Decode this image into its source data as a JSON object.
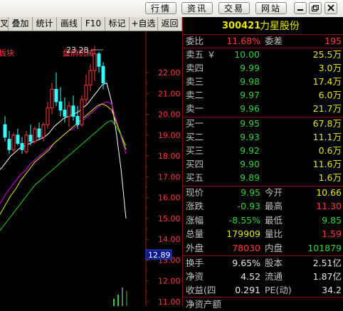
{
  "topbar": {
    "buttons": [
      "行情",
      "资讯",
      "交易",
      "网站"
    ],
    "window_controls": [
      "minimize-icon",
      "restore-icon",
      "close-icon"
    ]
  },
  "toolbar": {
    "items": [
      "叉",
      "叠加",
      "统计",
      "画线",
      "F10",
      "标记",
      "+自选",
      "返回"
    ]
  },
  "chart": {
    "annotations": [
      "板块",
      "盘前机械",
      "23.28"
    ],
    "y_ticks": [
      "22.00",
      "21.00",
      "20.00",
      "19.00",
      "18.00",
      "17.00",
      "16.00",
      "15.00",
      "14.00",
      "13.00",
      "12.00",
      "11.00"
    ],
    "current_price_tag": "12.89",
    "colors": {
      "up": "#ff3a3a",
      "down": "#33ffff",
      "ma_white": "#ffffff",
      "ma_yellow": "#e8e800",
      "ma_magenta": "#e000e0",
      "ma_green": "#20d020",
      "volume": "#31d13a"
    }
  },
  "chart_data": {
    "type": "candlestick",
    "y_range": [
      10.8,
      23.5
    ],
    "candles": [
      {
        "o": 19.5,
        "h": 19.9,
        "l": 18.7,
        "c": 18.9
      },
      {
        "o": 18.8,
        "h": 19.2,
        "l": 18.1,
        "c": 18.3
      },
      {
        "o": 18.3,
        "h": 19.1,
        "l": 18.2,
        "c": 19.0
      },
      {
        "o": 19.0,
        "h": 19.3,
        "l": 18.5,
        "c": 18.6
      },
      {
        "o": 18.6,
        "h": 18.9,
        "l": 18.1,
        "c": 18.3
      },
      {
        "o": 18.2,
        "h": 19.2,
        "l": 18.1,
        "c": 19.0
      },
      {
        "o": 19.0,
        "h": 19.5,
        "l": 18.5,
        "c": 18.7
      },
      {
        "o": 18.7,
        "h": 19.4,
        "l": 18.6,
        "c": 19.3
      },
      {
        "o": 19.3,
        "h": 19.6,
        "l": 18.8,
        "c": 18.9
      },
      {
        "o": 18.9,
        "h": 19.6,
        "l": 18.7,
        "c": 19.5
      },
      {
        "o": 19.5,
        "h": 20.6,
        "l": 19.3,
        "c": 20.3
      },
      {
        "o": 20.3,
        "h": 21.5,
        "l": 20.0,
        "c": 21.2
      },
      {
        "o": 21.2,
        "h": 22.0,
        "l": 20.4,
        "c": 20.6
      },
      {
        "o": 20.6,
        "h": 21.3,
        "l": 19.9,
        "c": 20.2
      },
      {
        "o": 20.2,
        "h": 20.8,
        "l": 19.6,
        "c": 19.9
      },
      {
        "o": 19.9,
        "h": 20.6,
        "l": 19.4,
        "c": 20.4
      },
      {
        "o": 20.4,
        "h": 20.9,
        "l": 19.7,
        "c": 19.9
      },
      {
        "o": 19.9,
        "h": 20.4,
        "l": 19.3,
        "c": 19.5
      },
      {
        "o": 19.5,
        "h": 20.9,
        "l": 19.4,
        "c": 20.7
      },
      {
        "o": 20.7,
        "h": 21.9,
        "l": 20.5,
        "c": 21.4
      },
      {
        "o": 21.4,
        "h": 22.4,
        "l": 21.1,
        "c": 22.1
      },
      {
        "o": 22.1,
        "h": 23.28,
        "l": 21.6,
        "c": 22.9
      },
      {
        "o": 22.9,
        "h": 23.0,
        "l": 22.0,
        "c": 22.3
      },
      {
        "o": 22.3,
        "h": 22.5,
        "l": 21.2,
        "c": 21.5
      }
    ],
    "ma": [
      {
        "name": "MA-white",
        "color": "#ffffff",
        "values": [
          17.2,
          17.4,
          17.7,
          18.0,
          18.2,
          18.4,
          18.5,
          18.6,
          18.7,
          18.8,
          18.9,
          19.1,
          19.4,
          19.6,
          19.8,
          19.9,
          20.0,
          20.1,
          20.3,
          20.5,
          20.8,
          21.1,
          21.4,
          21.5,
          20.6,
          19.1,
          17.3,
          15.0
        ]
      },
      {
        "name": "MA-magenta",
        "color": "#e000e0",
        "values": [
          15.5,
          15.8,
          16.2,
          16.5,
          16.8,
          17.1,
          17.3,
          17.6,
          17.8,
          18.0,
          18.2,
          18.4,
          18.6,
          18.8,
          19.0,
          19.2,
          19.3,
          19.5,
          19.7,
          19.9,
          20.1,
          20.3,
          20.5,
          20.6,
          20.5,
          19.7,
          18.9,
          18.1
        ]
      },
      {
        "name": "MA-yellow",
        "color": "#e8e800",
        "values": [
          14.9,
          15.3,
          15.7,
          16.1,
          16.4,
          16.8,
          17.1,
          17.4,
          17.7,
          17.9,
          18.1,
          18.3,
          18.6,
          18.8,
          19.0,
          19.2,
          19.4,
          19.6,
          19.8,
          20.0,
          20.2,
          20.4,
          20.5,
          20.4,
          20.2,
          19.6,
          19.0,
          18.3
        ]
      },
      {
        "name": "MA-green",
        "color": "#20d020",
        "values": [
          14.2,
          14.5,
          14.8,
          15.1,
          15.4,
          15.7,
          16.0,
          16.3,
          16.6,
          16.8,
          17.0,
          17.2,
          17.4,
          17.6,
          17.8,
          18.0,
          18.2,
          18.4,
          18.6,
          18.8,
          19.0,
          19.2,
          19.4,
          19.6,
          19.7,
          19.4,
          19.0,
          18.5
        ]
      }
    ]
  },
  "panel": {
    "code": "300421",
    "name": "力星股份",
    "ratio_label": "委比",
    "ratio_value": "11.68%",
    "diff_label": "委差",
    "diff_value": "195",
    "sell_currency_mark": "￥",
    "sells": [
      {
        "label": "卖五",
        "price": "10.00",
        "vol": "25.5万"
      },
      {
        "label": "卖四",
        "price": "9.99",
        "vol": "3.0万"
      },
      {
        "label": "卖三",
        "price": "9.98",
        "vol": "17.4万"
      },
      {
        "label": "卖二",
        "price": "9.97",
        "vol": "6.0万"
      },
      {
        "label": "卖一",
        "price": "9.96",
        "vol": "21.7万"
      }
    ],
    "buys": [
      {
        "label": "买一",
        "price": "9.95",
        "vol": "67.8万"
      },
      {
        "label": "买二",
        "price": "9.93",
        "vol": "11.1万"
      },
      {
        "label": "买三",
        "price": "9.92",
        "vol": "0.6万"
      },
      {
        "label": "买四",
        "price": "9.90",
        "vol": "11.6万"
      },
      {
        "label": "买五",
        "price": "9.89",
        "vol": "1.6万"
      }
    ],
    "stats": [
      {
        "l1": "现价",
        "v1": "9.95",
        "c1": "green",
        "l2": "今开",
        "v2": "10.66",
        "c2": "yellow"
      },
      {
        "l1": "涨跌",
        "v1": "-0.93",
        "c1": "green",
        "l2": "最高",
        "v2": "11.30",
        "c2": "red"
      },
      {
        "l1": "涨幅",
        "v1": "-8.55%",
        "c1": "green",
        "l2": "最低",
        "v2": "9.85",
        "c2": "green"
      },
      {
        "l1": "总量",
        "v1": "179909",
        "c1": "yellow",
        "l2": "量比",
        "v2": "1.59",
        "c2": "red"
      },
      {
        "l1": "外盘",
        "v1": "78030",
        "c1": "red",
        "l2": "内盘",
        "v2": "101879",
        "c2": "green"
      }
    ],
    "finance": [
      {
        "l1": "换手",
        "v1": "9.65%",
        "l2": "股本",
        "v2": "2.51亿"
      },
      {
        "l1": "净资",
        "v1": "4.52",
        "l2": "流通",
        "v2": "1.87亿"
      },
      {
        "l1": "收益(四",
        "v1": "0.291",
        "l2": "PE(动)",
        "v2": "34.2"
      }
    ],
    "bottom_cut": "净资产额"
  }
}
